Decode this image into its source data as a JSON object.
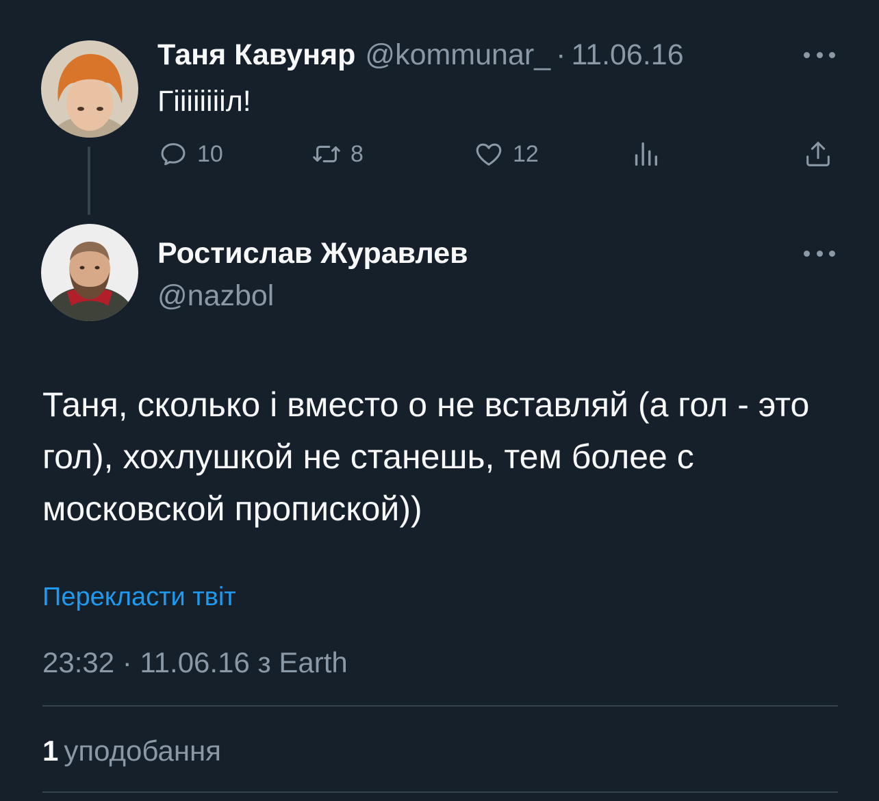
{
  "parent_tweet": {
    "author_name": "Таня Кавуняр",
    "handle": "@kommunar_",
    "separator": "·",
    "date": "11.06.16",
    "text": "Гііііііііл!",
    "actions": {
      "replies": "10",
      "retweets": "8",
      "likes": "12"
    },
    "icons": [
      "reply-icon",
      "retweet-icon",
      "like-icon",
      "views-icon",
      "share-icon",
      "more-icon"
    ]
  },
  "reply_tweet": {
    "author_name": "Ростислав Журавлев",
    "handle": "@nazbol",
    "text": "Таня, сколько і вместо о не вставляй (а гол - это гол), хохлушкой не станешь, тем более с московской пропиской))",
    "translate_link": "Перекласти твіт",
    "meta": "23:32 · 11.06.16 з Earth",
    "likes_count": "1",
    "likes_label": "уподобання"
  },
  "colors": {
    "background": "#15202b",
    "text_primary": "#f7f9f9",
    "text_secondary": "#8b98a5",
    "link": "#1d9bf0",
    "divider": "#38444d"
  }
}
